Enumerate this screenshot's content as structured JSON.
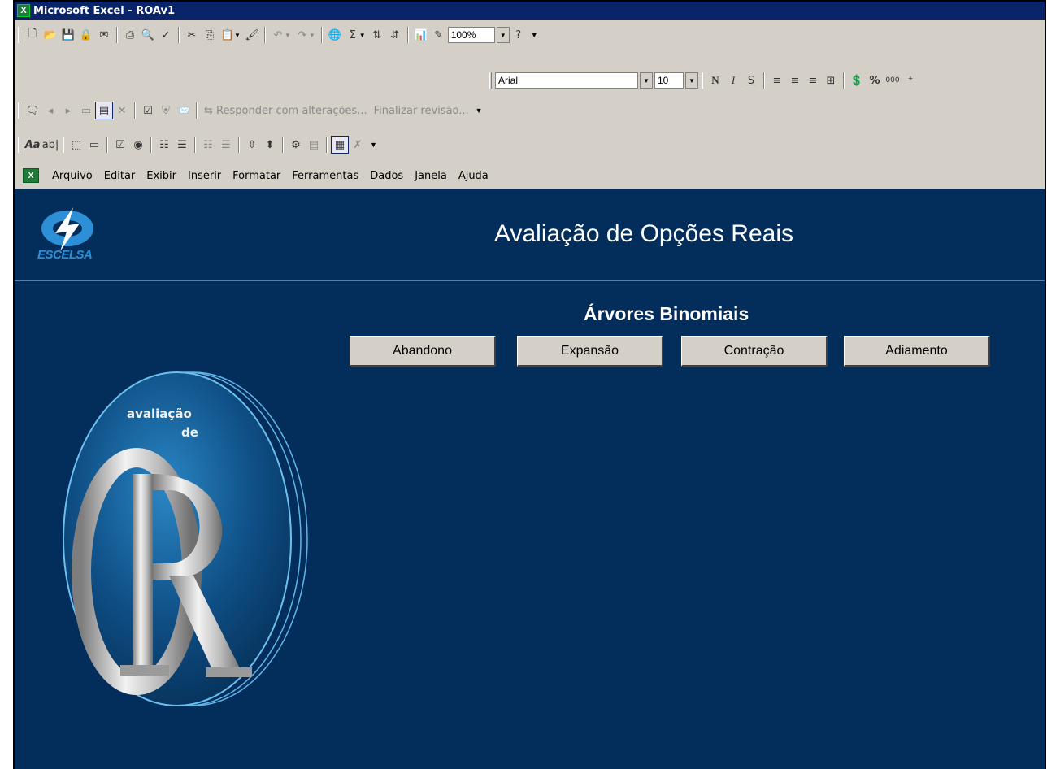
{
  "window": {
    "title": "Microsoft Excel - ROAv1"
  },
  "icons": {
    "standard_toolbar": [
      "new-icon",
      "open-icon",
      "save-icon",
      "permission-icon",
      "email-icon",
      "print-icon",
      "print-preview-icon",
      "spelling-icon",
      "cut-icon",
      "copy-icon",
      "paste-icon",
      "format-painter-icon",
      "undo-icon",
      "redo-icon",
      "hyperlink-icon",
      "autosum-icon",
      "sort-ascending-icon",
      "sort-descending-icon",
      "chart-wizard-icon",
      "drawing-icon",
      "help-icon"
    ],
    "review_toolbar": [
      "new-comment-icon",
      "prev-comment-icon",
      "next-comment-icon",
      "show-comment-icon",
      "show-all-comments-icon",
      "delete-comment-icon",
      "track-changes-icon",
      "protect-icon",
      "send-icon",
      "reply-icon"
    ],
    "forms_toolbar": [
      "label-icon",
      "edit-box-icon",
      "group-box-icon",
      "button-icon",
      "checkbox-icon",
      "option-button-icon",
      "list-box-icon",
      "combo-box-icon",
      "combo-list-icon",
      "combo-dropdown-icon",
      "scroll-bar-icon",
      "spinner-icon",
      "control-properties-icon",
      "edit-code-icon",
      "toggle-grid-icon",
      "run-dialog-icon"
    ]
  },
  "toolbar": {
    "zoom": "100%",
    "font_name": "Arial",
    "font_size": "10",
    "bold": "N",
    "italic": "I",
    "underline": "S",
    "percent": "%",
    "thousands": "000"
  },
  "review": {
    "reply_label": "Responder com alterações...",
    "end_review_label": "Finalizar revisão..."
  },
  "menu": {
    "items": [
      "Arquivo",
      "Editar",
      "Exibir",
      "Inserir",
      "Formatar",
      "Ferramentas",
      "Dados",
      "Janela",
      "Ajuda"
    ]
  },
  "sheet": {
    "brand": "ESCELSA",
    "title": "Avaliação de Opções Reais",
    "section_title": "Árvores Binomiais",
    "buttons": [
      "Abandono",
      "Expansão",
      "Contração",
      "Adiamento"
    ],
    "emblem_line1": "avaliação",
    "emblem_line2": "de"
  },
  "colors": {
    "title_bar": "#0a246a",
    "sheet_background": "#032d5a",
    "chrome": "#d4d0c8",
    "logo_blue": "#2d8fd6"
  }
}
